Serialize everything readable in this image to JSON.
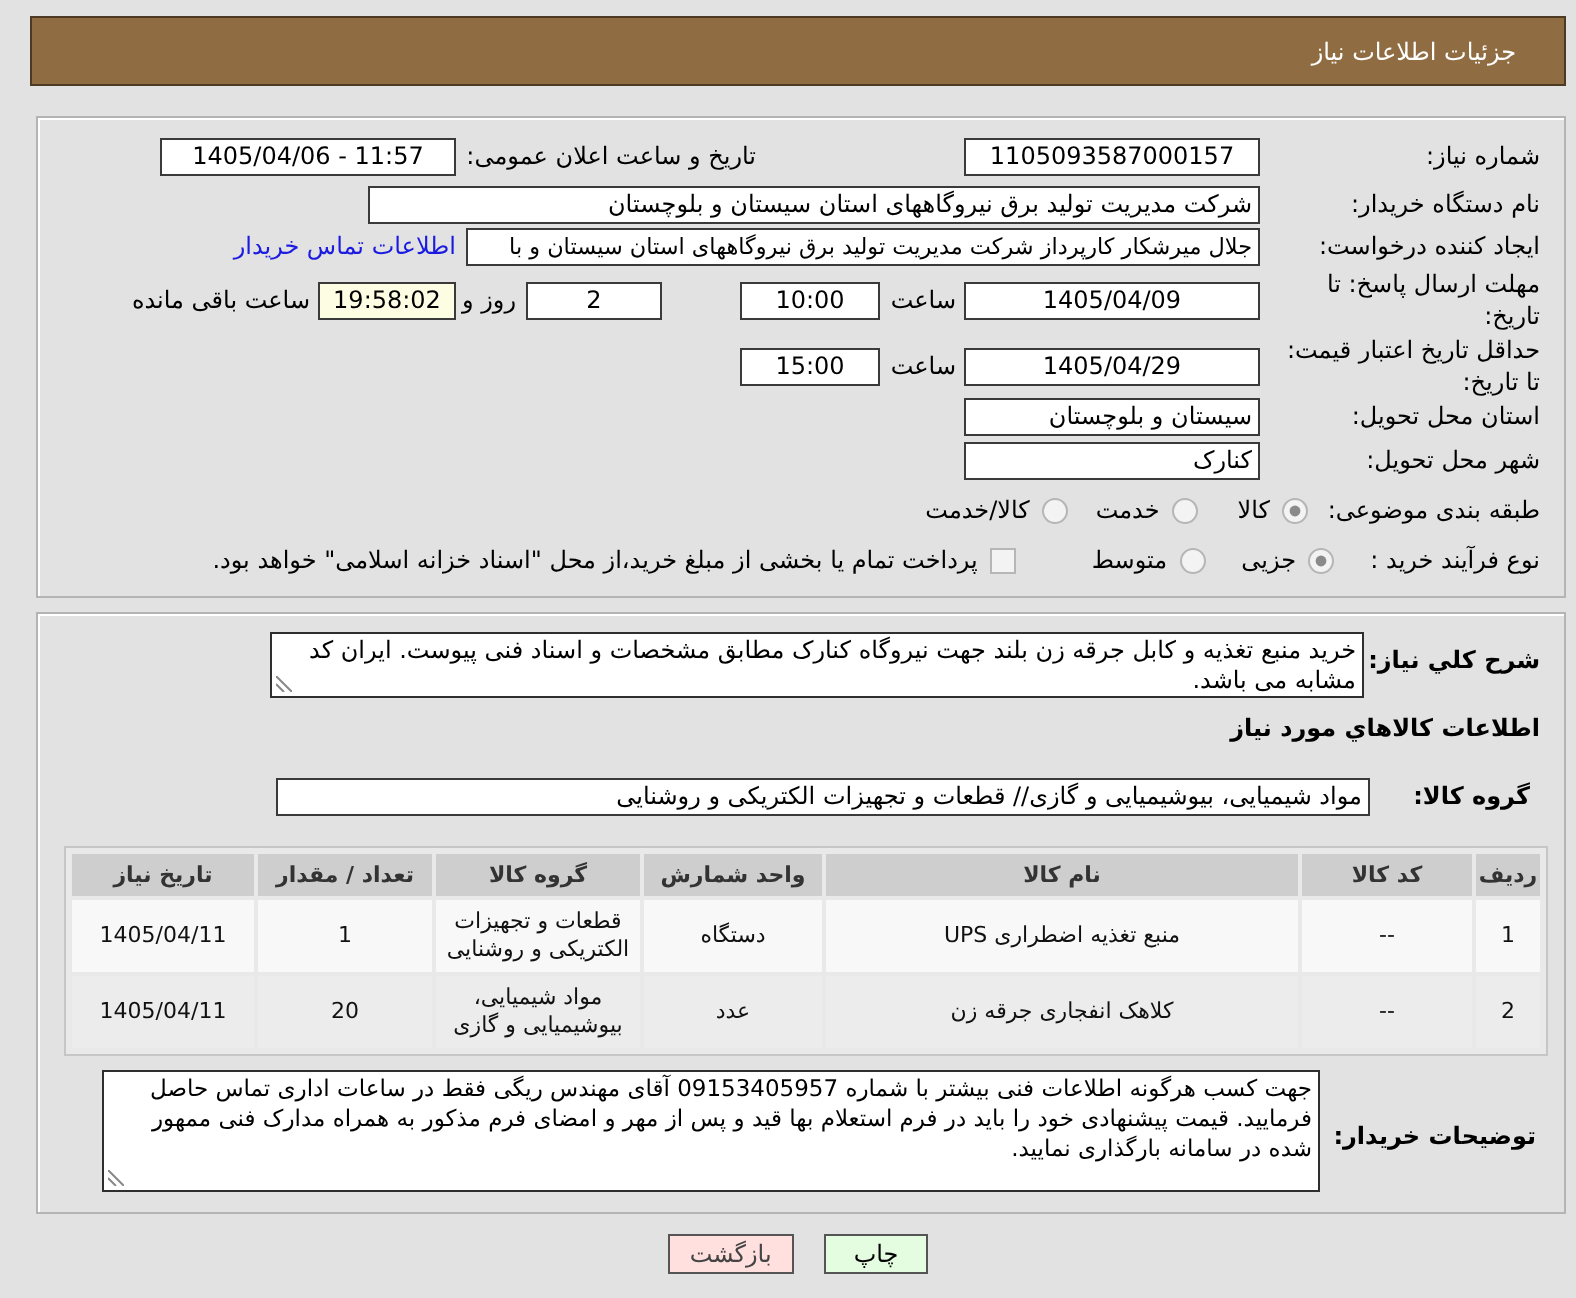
{
  "header": {
    "title": "جزئیات اطلاعات نیاز"
  },
  "details": {
    "need_number": {
      "label": "شماره نیاز:",
      "value": "1105093587000157"
    },
    "announce_datetime": {
      "label": "تاریخ و ساعت اعلان عمومی:",
      "value": "1405/04/06 - 11:57"
    },
    "buyer_org": {
      "label": "نام دستگاه خریدار:",
      "value": "شرکت مدیریت تولید برق نیروگاههای استان سیستان و بلوچستان"
    },
    "requester": {
      "label": "ایجاد کننده درخواست:",
      "value": "جلال میرشکار کارپرداز شرکت مدیریت تولید برق نیروگاههای استان سیستان و با",
      "link": "اطلاعات تماس خریدار"
    },
    "reply_deadline": {
      "label": "مهلت ارسال پاسخ: تا تاریخ:",
      "date": "1405/04/09",
      "time_label": "ساعت",
      "time": "10:00",
      "days": "2",
      "days_label": "روز و",
      "remaining": "19:58:02",
      "remaining_label": "ساعت باقی مانده"
    },
    "price_validity": {
      "label": "حداقل تاریخ اعتبار قیمت: تا تاریخ:",
      "date": "1405/04/29",
      "time_label": "ساعت",
      "time": "15:00"
    },
    "province": {
      "label": "استان محل تحویل:",
      "value": "سیستان و بلوچستان"
    },
    "city": {
      "label": "شهر محل تحویل:",
      "value": "کنارک"
    },
    "category": {
      "label": "طبقه بندی موضوعی:",
      "options": [
        {
          "label": "کالا",
          "selected": true
        },
        {
          "label": "خدمت",
          "selected": false
        },
        {
          "label": "کالا/خدمت",
          "selected": false
        }
      ]
    },
    "process": {
      "label": "نوع فرآیند خرید :",
      "options": [
        {
          "label": "جزیی",
          "selected": true
        },
        {
          "label": "متوسط",
          "selected": false
        }
      ],
      "treasury": {
        "checked": false,
        "label": "پرداخت تمام یا بخشی از مبلغ خرید،از محل \"اسناد خزانه اسلامی\" خواهد بود."
      }
    }
  },
  "summary": {
    "label": "شرح کلي نیاز:",
    "text": "خرید منبع تغذیه و کابل جرقه زن بلند جهت نیروگاه کنارک مطابق مشخصات و اسناد فنی پیوست. ایران کد مشابه می باشد."
  },
  "goods": {
    "title": "اطلاعات كالاهاي مورد نیاز",
    "group_label": "گروه کالا:",
    "group": "مواد شیمیایی، بیوشیمیایی و  گازی// قطعات و تجهیزات الکتریکی و روشنایی",
    "table": {
      "columns": [
        "ردیف",
        "کد کالا",
        "نام کالا",
        "واحد شمارش",
        "گروه کالا",
        "تعداد / مقدار",
        "تاریخ نیاز"
      ],
      "rows": [
        [
          "1",
          "--",
          "منبع تغذیه اضطراری UPS",
          "دستگاه",
          "قطعات و تجهیزات الکتریکی و روشنایی",
          "1",
          "1405/04/11"
        ],
        [
          "2",
          "--",
          "کلاهک انفجاری جرقه زن",
          "عدد",
          "مواد شیمیایی، بیوشیمیایی و گازی",
          "20",
          "1405/04/11"
        ]
      ]
    }
  },
  "buyer_notes": {
    "label": "توضیحات خریدار:",
    "text": "جهت کسب هرگونه اطلاعات فنی بیشتر با شماره 09153405957 آقای مهندس ریگی فقط در ساعات اداری تماس حاصل فرمایید. قیمت پیشنهادی خود را باید در فرم استعلام بها قید و پس از مهر و امضای فرم مذکور به همراه مدارک فنی ممهور شده در سامانه بارگذاری نمایید."
  },
  "buttons": [
    {
      "kind": "print",
      "label": "چاپ"
    },
    {
      "kind": "back",
      "label": "بازگشت"
    }
  ]
}
